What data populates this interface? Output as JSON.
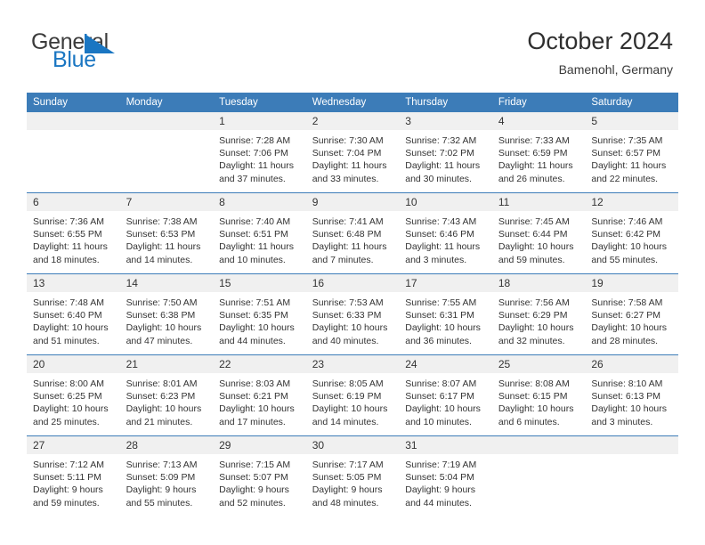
{
  "brand": {
    "name_top": "General",
    "name_bottom": "Blue",
    "icon": "triangle-flag-icon",
    "color_top": "#3b3b3b",
    "color_bottom": "#1a76c2"
  },
  "header": {
    "title": "October 2024",
    "subtitle": "Bamenohl, Germany"
  },
  "theme": {
    "header_blue": "#3c7cb8",
    "daynum_bg": "#f0f0f0",
    "text": "#333333"
  },
  "calendar": {
    "weekday_headers": [
      "Sunday",
      "Monday",
      "Tuesday",
      "Wednesday",
      "Thursday",
      "Friday",
      "Saturday"
    ],
    "weeks": [
      [
        {
          "day": "",
          "lines": []
        },
        {
          "day": "",
          "lines": []
        },
        {
          "day": "1",
          "lines": [
            "Sunrise: 7:28 AM",
            "Sunset: 7:06 PM",
            "Daylight: 11 hours",
            "and 37 minutes."
          ]
        },
        {
          "day": "2",
          "lines": [
            "Sunrise: 7:30 AM",
            "Sunset: 7:04 PM",
            "Daylight: 11 hours",
            "and 33 minutes."
          ]
        },
        {
          "day": "3",
          "lines": [
            "Sunrise: 7:32 AM",
            "Sunset: 7:02 PM",
            "Daylight: 11 hours",
            "and 30 minutes."
          ]
        },
        {
          "day": "4",
          "lines": [
            "Sunrise: 7:33 AM",
            "Sunset: 6:59 PM",
            "Daylight: 11 hours",
            "and 26 minutes."
          ]
        },
        {
          "day": "5",
          "lines": [
            "Sunrise: 7:35 AM",
            "Sunset: 6:57 PM",
            "Daylight: 11 hours",
            "and 22 minutes."
          ]
        }
      ],
      [
        {
          "day": "6",
          "lines": [
            "Sunrise: 7:36 AM",
            "Sunset: 6:55 PM",
            "Daylight: 11 hours",
            "and 18 minutes."
          ]
        },
        {
          "day": "7",
          "lines": [
            "Sunrise: 7:38 AM",
            "Sunset: 6:53 PM",
            "Daylight: 11 hours",
            "and 14 minutes."
          ]
        },
        {
          "day": "8",
          "lines": [
            "Sunrise: 7:40 AM",
            "Sunset: 6:51 PM",
            "Daylight: 11 hours",
            "and 10 minutes."
          ]
        },
        {
          "day": "9",
          "lines": [
            "Sunrise: 7:41 AM",
            "Sunset: 6:48 PM",
            "Daylight: 11 hours",
            "and 7 minutes."
          ]
        },
        {
          "day": "10",
          "lines": [
            "Sunrise: 7:43 AM",
            "Sunset: 6:46 PM",
            "Daylight: 11 hours",
            "and 3 minutes."
          ]
        },
        {
          "day": "11",
          "lines": [
            "Sunrise: 7:45 AM",
            "Sunset: 6:44 PM",
            "Daylight: 10 hours",
            "and 59 minutes."
          ]
        },
        {
          "day": "12",
          "lines": [
            "Sunrise: 7:46 AM",
            "Sunset: 6:42 PM",
            "Daylight: 10 hours",
            "and 55 minutes."
          ]
        }
      ],
      [
        {
          "day": "13",
          "lines": [
            "Sunrise: 7:48 AM",
            "Sunset: 6:40 PM",
            "Daylight: 10 hours",
            "and 51 minutes."
          ]
        },
        {
          "day": "14",
          "lines": [
            "Sunrise: 7:50 AM",
            "Sunset: 6:38 PM",
            "Daylight: 10 hours",
            "and 47 minutes."
          ]
        },
        {
          "day": "15",
          "lines": [
            "Sunrise: 7:51 AM",
            "Sunset: 6:35 PM",
            "Daylight: 10 hours",
            "and 44 minutes."
          ]
        },
        {
          "day": "16",
          "lines": [
            "Sunrise: 7:53 AM",
            "Sunset: 6:33 PM",
            "Daylight: 10 hours",
            "and 40 minutes."
          ]
        },
        {
          "day": "17",
          "lines": [
            "Sunrise: 7:55 AM",
            "Sunset: 6:31 PM",
            "Daylight: 10 hours",
            "and 36 minutes."
          ]
        },
        {
          "day": "18",
          "lines": [
            "Sunrise: 7:56 AM",
            "Sunset: 6:29 PM",
            "Daylight: 10 hours",
            "and 32 minutes."
          ]
        },
        {
          "day": "19",
          "lines": [
            "Sunrise: 7:58 AM",
            "Sunset: 6:27 PM",
            "Daylight: 10 hours",
            "and 28 minutes."
          ]
        }
      ],
      [
        {
          "day": "20",
          "lines": [
            "Sunrise: 8:00 AM",
            "Sunset: 6:25 PM",
            "Daylight: 10 hours",
            "and 25 minutes."
          ]
        },
        {
          "day": "21",
          "lines": [
            "Sunrise: 8:01 AM",
            "Sunset: 6:23 PM",
            "Daylight: 10 hours",
            "and 21 minutes."
          ]
        },
        {
          "day": "22",
          "lines": [
            "Sunrise: 8:03 AM",
            "Sunset: 6:21 PM",
            "Daylight: 10 hours",
            "and 17 minutes."
          ]
        },
        {
          "day": "23",
          "lines": [
            "Sunrise: 8:05 AM",
            "Sunset: 6:19 PM",
            "Daylight: 10 hours",
            "and 14 minutes."
          ]
        },
        {
          "day": "24",
          "lines": [
            "Sunrise: 8:07 AM",
            "Sunset: 6:17 PM",
            "Daylight: 10 hours",
            "and 10 minutes."
          ]
        },
        {
          "day": "25",
          "lines": [
            "Sunrise: 8:08 AM",
            "Sunset: 6:15 PM",
            "Daylight: 10 hours",
            "and 6 minutes."
          ]
        },
        {
          "day": "26",
          "lines": [
            "Sunrise: 8:10 AM",
            "Sunset: 6:13 PM",
            "Daylight: 10 hours",
            "and 3 minutes."
          ]
        }
      ],
      [
        {
          "day": "27",
          "lines": [
            "Sunrise: 7:12 AM",
            "Sunset: 5:11 PM",
            "Daylight: 9 hours",
            "and 59 minutes."
          ]
        },
        {
          "day": "28",
          "lines": [
            "Sunrise: 7:13 AM",
            "Sunset: 5:09 PM",
            "Daylight: 9 hours",
            "and 55 minutes."
          ]
        },
        {
          "day": "29",
          "lines": [
            "Sunrise: 7:15 AM",
            "Sunset: 5:07 PM",
            "Daylight: 9 hours",
            "and 52 minutes."
          ]
        },
        {
          "day": "30",
          "lines": [
            "Sunrise: 7:17 AM",
            "Sunset: 5:05 PM",
            "Daylight: 9 hours",
            "and 48 minutes."
          ]
        },
        {
          "day": "31",
          "lines": [
            "Sunrise: 7:19 AM",
            "Sunset: 5:04 PM",
            "Daylight: 9 hours",
            "and 44 minutes."
          ]
        },
        {
          "day": "",
          "lines": []
        },
        {
          "day": "",
          "lines": []
        }
      ]
    ]
  }
}
